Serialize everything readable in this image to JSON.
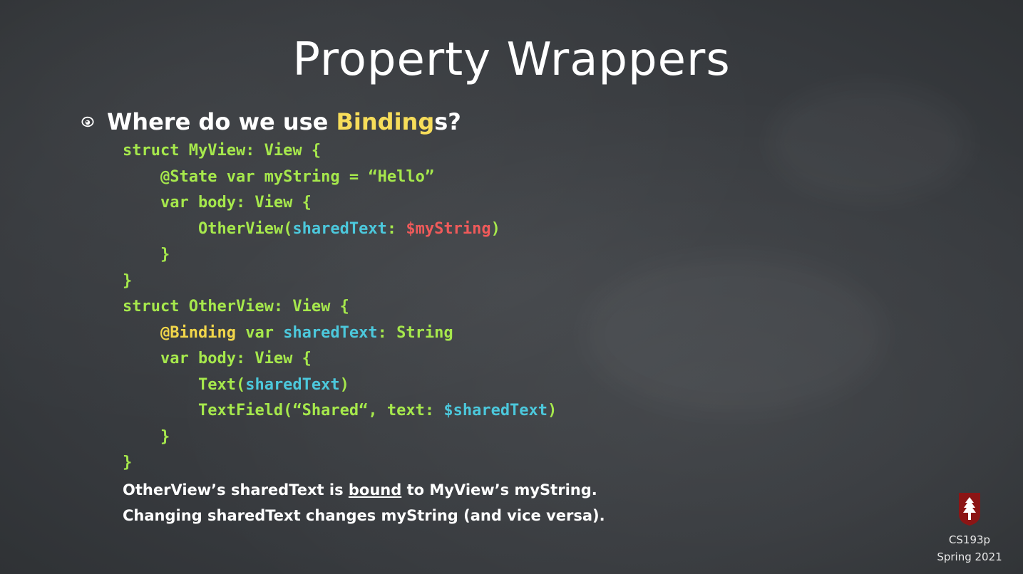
{
  "slide": {
    "title": "Property Wrappers",
    "bullet": {
      "prefix": "Where do we use ",
      "highlight": "Binding",
      "suffix": "s?"
    },
    "code": {
      "lines": [
        {
          "indent": "",
          "tokens": [
            {
              "text": "struct MyView: View {",
              "color": "green"
            }
          ]
        },
        {
          "indent": "    ",
          "tokens": [
            {
              "text": "@State var myString = “Hello”",
              "color": "green"
            }
          ]
        },
        {
          "indent": "    ",
          "tokens": [
            {
              "text": "var body: View {",
              "color": "green"
            }
          ]
        },
        {
          "indent": "        ",
          "tokens": [
            {
              "text": "OtherView(",
              "color": "green"
            },
            {
              "text": "sharedText",
              "color": "cyan"
            },
            {
              "text": ": ",
              "color": "green"
            },
            {
              "text": "$myString",
              "color": "red"
            },
            {
              "text": ")",
              "color": "green"
            }
          ]
        },
        {
          "indent": "    ",
          "tokens": [
            {
              "text": "}",
              "color": "green"
            }
          ]
        },
        {
          "indent": "",
          "tokens": [
            {
              "text": "}",
              "color": "green"
            }
          ]
        },
        {
          "indent": "",
          "tokens": [
            {
              "text": "struct OtherView: View {",
              "color": "green"
            }
          ]
        },
        {
          "indent": "    ",
          "tokens": [
            {
              "text": "@Binding",
              "color": "yellow"
            },
            {
              "text": " var ",
              "color": "green"
            },
            {
              "text": "sharedText",
              "color": "cyan"
            },
            {
              "text": ": String",
              "color": "green"
            }
          ]
        },
        {
          "indent": "    ",
          "tokens": [
            {
              "text": "var body: View {",
              "color": "green"
            }
          ]
        },
        {
          "indent": "        ",
          "tokens": [
            {
              "text": "Text(",
              "color": "green"
            },
            {
              "text": "sharedText",
              "color": "cyan"
            },
            {
              "text": ")",
              "color": "green"
            }
          ]
        },
        {
          "indent": "        ",
          "tokens": [
            {
              "text": "TextField(“Shared“, text: ",
              "color": "green"
            },
            {
              "text": "$sharedText",
              "color": "cyan"
            },
            {
              "text": ")",
              "color": "green"
            }
          ]
        },
        {
          "indent": "    ",
          "tokens": [
            {
              "text": "}",
              "color": "green"
            }
          ]
        },
        {
          "indent": "",
          "tokens": [
            {
              "text": "}",
              "color": "green"
            }
          ]
        }
      ]
    },
    "notes": {
      "line1_a": "OtherView’s sharedText is ",
      "line1_underlined": "bound",
      "line1_b": " to MyView’s myString.",
      "line2": "Changing sharedText changes myString (and vice versa)."
    },
    "footer": {
      "course": "CS193p",
      "term": "Spring 2021"
    },
    "colors": {
      "background": "#3b3e42",
      "code_green": "#a6e84c",
      "code_cyan": "#4cc8dc",
      "code_red": "#f05a5a",
      "code_yellow": "#f2d64a",
      "highlight_yellow": "#f7dd5a",
      "logo_red": "#8c1515"
    },
    "icons": {
      "bullet": "eye-icon",
      "logo": "stanford-tree-logo"
    }
  }
}
